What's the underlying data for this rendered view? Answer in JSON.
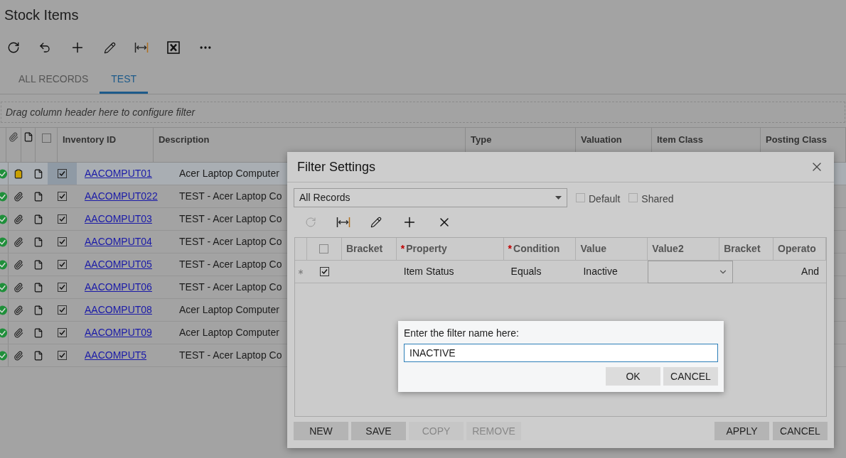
{
  "page": {
    "title": "Stock Items"
  },
  "tabs": [
    {
      "label": "ALL RECORDS",
      "selected": false
    },
    {
      "label": "TEST",
      "selected": true
    }
  ],
  "filter_bar": {
    "hint": "Drag column header here to configure filter"
  },
  "grid": {
    "all_checked": false,
    "columns": [
      "Inventory ID",
      "Description",
      "Type",
      "Valuation",
      "Item Class",
      "Posting Class"
    ],
    "rows": [
      {
        "inventory_id": "AACOMPUT01",
        "description": "Acer Laptop Computer",
        "attachment_highlighted": true,
        "checked": true,
        "selected": true
      },
      {
        "inventory_id": "AACOMPUT022",
        "description": "TEST - Acer Laptop Co",
        "attachment_highlighted": false,
        "checked": true,
        "selected": false
      },
      {
        "inventory_id": "AACOMPUT03",
        "description": "TEST - Acer Laptop Co",
        "attachment_highlighted": false,
        "checked": true,
        "selected": false
      },
      {
        "inventory_id": "AACOMPUT04",
        "description": "TEST - Acer Laptop Co",
        "attachment_highlighted": false,
        "checked": true,
        "selected": false
      },
      {
        "inventory_id": "AACOMPUT05",
        "description": "TEST - Acer Laptop Co",
        "attachment_highlighted": false,
        "checked": true,
        "selected": false
      },
      {
        "inventory_id": "AACOMPUT06",
        "description": "TEST - Acer Laptop Co",
        "attachment_highlighted": false,
        "checked": true,
        "selected": false
      },
      {
        "inventory_id": "AACOMPUT08",
        "description": "Acer Laptop Computer",
        "attachment_highlighted": false,
        "checked": true,
        "selected": false
      },
      {
        "inventory_id": "AACOMPUT09",
        "description": "Acer Laptop Computer",
        "attachment_highlighted": false,
        "checked": true,
        "selected": false
      },
      {
        "inventory_id": "AACOMPUT5",
        "description": "TEST - Acer Laptop Co",
        "attachment_highlighted": false,
        "checked": true,
        "selected": false
      }
    ]
  },
  "dialog": {
    "title": "Filter Settings",
    "filter_select": {
      "value": "All Records"
    },
    "default": {
      "label": "Default",
      "checked": false
    },
    "shared": {
      "label": "Shared",
      "checked": false
    },
    "all_checked": false,
    "columns": [
      {
        "label": "Bracket"
      },
      {
        "label": "Property",
        "required_mark": "*"
      },
      {
        "label": "Condition",
        "required_mark": "*"
      },
      {
        "label": "Value"
      },
      {
        "label": "Value2"
      },
      {
        "label": "Bracket"
      },
      {
        "label": "Operato"
      }
    ],
    "rows": [
      {
        "checked": true,
        "property": "Item Status",
        "condition": "Equals",
        "value": "Inactive",
        "operator": "And"
      }
    ],
    "prompt": {
      "label": "Enter the filter name here:",
      "value": "INACTIVE",
      "buttons": [
        "OK",
        "CANCEL"
      ]
    },
    "left_buttons": [
      {
        "label": "NEW",
        "disabled": false
      },
      {
        "label": "SAVE",
        "disabled": false
      },
      {
        "label": "COPY",
        "disabled": true
      },
      {
        "label": "REMOVE",
        "disabled": true
      }
    ],
    "right_buttons": [
      {
        "label": "APPLY",
        "disabled": false
      },
      {
        "label": "CANCEL",
        "disabled": false
      }
    ]
  }
}
